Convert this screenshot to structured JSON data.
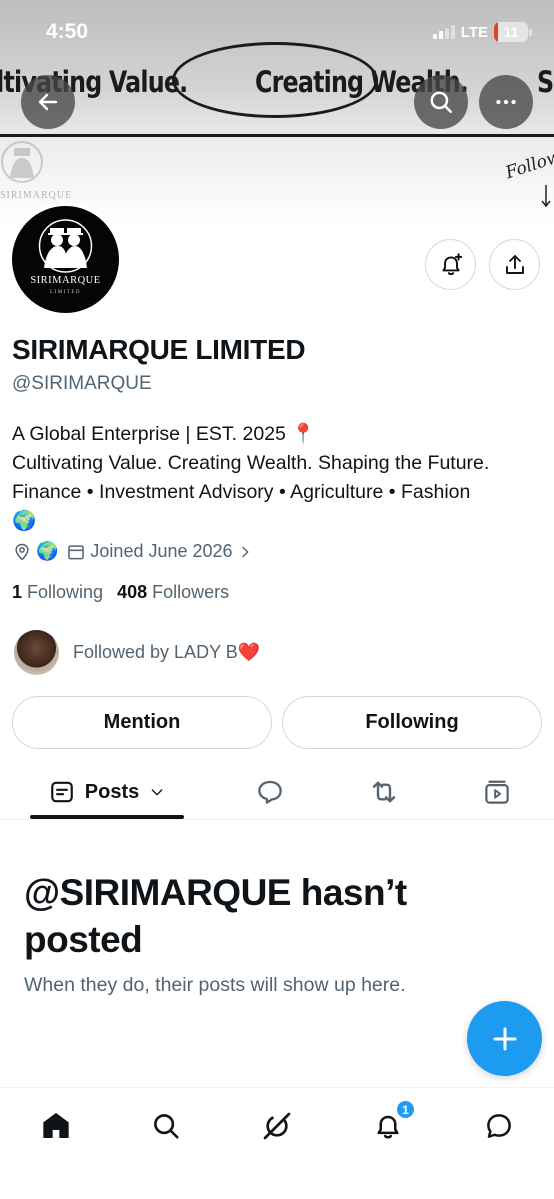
{
  "status_bar": {
    "time": "4:50",
    "network": "LTE",
    "battery": "11",
    "battery_level": 0.11,
    "battery_color": "#e0402f"
  },
  "banner": {
    "phrases": [
      "ultivating Value.",
      "Creating Wealth.",
      "Shaping the Futu"
    ],
    "watermark_text": "SIRIMARQUE",
    "follow_script": "Follow"
  },
  "header_actions": {
    "back": "arrow-left-icon",
    "search": "search-icon",
    "more": "more-icon"
  },
  "avatar": {
    "brand": "SIRIMARQUE",
    "sub": "LIMITED"
  },
  "profile": {
    "display_name": "SIRIMARQUE LIMITED",
    "handle": "@SIRIMARQUE",
    "bio_lines": [
      "A Global Enterprise | EST. 2025 📍",
      "Cultivating Value. Creating Wealth. Shaping the Future.",
      "Finance • Investment Advisory • Agriculture • Fashion",
      "🌍"
    ],
    "location": "🌍",
    "joined": "Joined June 2026",
    "following_count": "1",
    "following_label": "Following",
    "followers_count": "408",
    "followers_label": "Followers",
    "followed_by": "Followed by LADY B❤️"
  },
  "actions": {
    "mention": "Mention",
    "following": "Following"
  },
  "tabs": {
    "posts": "Posts",
    "active": "posts"
  },
  "empty_state": {
    "title": "@SIRIMARQUE hasn’t posted",
    "subtitle": "When they do, their posts will show up here."
  },
  "bottom_nav": {
    "notification_badge": "1"
  },
  "colors": {
    "accent": "#1d9bf0",
    "text": "#0f1419",
    "secondary": "#536471",
    "border": "#cfd9de"
  }
}
